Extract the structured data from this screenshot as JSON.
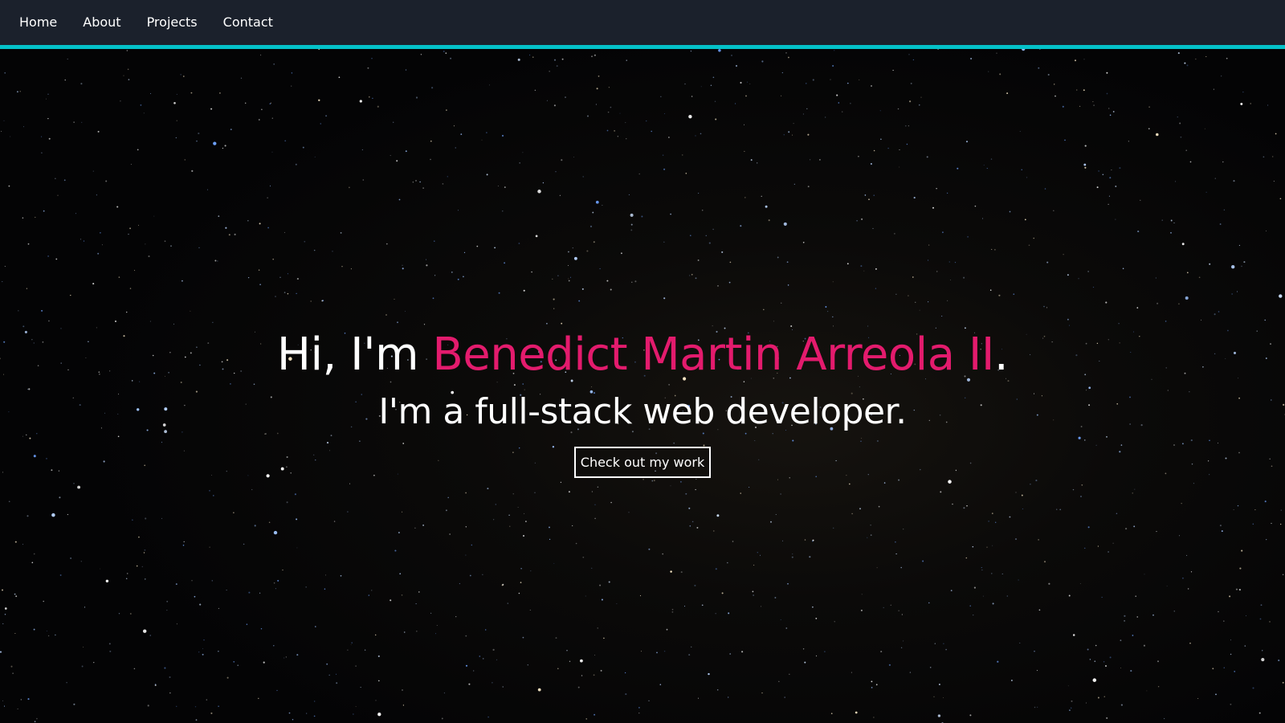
{
  "nav": {
    "items": [
      {
        "label": "Home"
      },
      {
        "label": "About"
      },
      {
        "label": "Projects"
      },
      {
        "label": "Contact"
      }
    ]
  },
  "hero": {
    "greeting_prefix": "Hi, I'm ",
    "name": "Benedict Martin Arreola II",
    "greeting_suffix": ".",
    "tagline": "I'm a full-stack web developer.",
    "cta_label": "Check out my work"
  },
  "colors": {
    "nav_background": "#1b212c",
    "nav_accent": "#04c2c9",
    "name_highlight": "#e31b6d",
    "text": "#ffffff"
  }
}
